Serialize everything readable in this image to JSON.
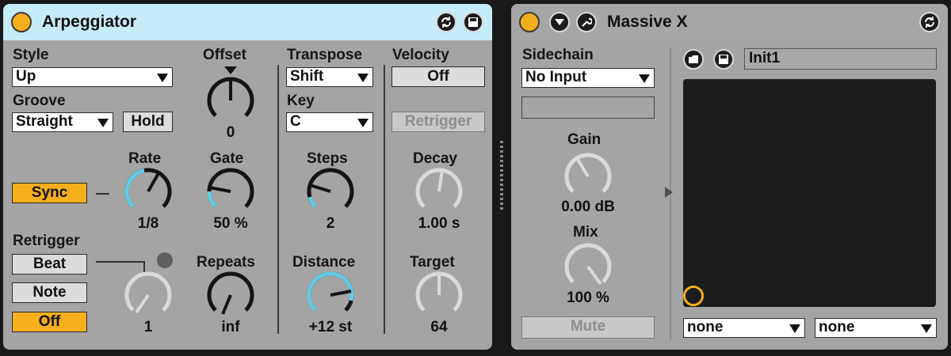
{
  "arpeggiator": {
    "title": "Arpeggiator",
    "style": {
      "label": "Style",
      "value": "Up"
    },
    "groove": {
      "label": "Groove",
      "value": "Straight"
    },
    "hold_label": "Hold",
    "offset": {
      "label": "Offset",
      "value": "0"
    },
    "sync_label": "Sync",
    "rate": {
      "label": "Rate",
      "value": "1/8"
    },
    "gate": {
      "label": "Gate",
      "value": "50 %"
    },
    "retrigger": {
      "label": "Retrigger",
      "beat": "Beat",
      "note": "Note",
      "off": "Off",
      "value": "1"
    },
    "repeats": {
      "label": "Repeats",
      "value": "inf"
    },
    "transpose": {
      "label": "Transpose",
      "value": "Shift"
    },
    "key": {
      "label": "Key",
      "value": "C"
    },
    "steps": {
      "label": "Steps",
      "value": "2"
    },
    "distance": {
      "label": "Distance",
      "value": "+12 st"
    },
    "velocity": {
      "label": "Velocity",
      "value": "Off",
      "retrigger_label": "Retrigger"
    },
    "decay": {
      "label": "Decay",
      "value": "1.00 s"
    },
    "target": {
      "label": "Target",
      "value": "64"
    }
  },
  "massive": {
    "title": "Massive X",
    "sidechain": {
      "label": "Sidechain",
      "value": "No Input"
    },
    "gain": {
      "label": "Gain",
      "value": "0.00 dB"
    },
    "mix": {
      "label": "Mix",
      "value": "100 %"
    },
    "mute_label": "Mute",
    "preset_name": "Init1",
    "macro_left": "none",
    "macro_right": "none"
  },
  "colors": {
    "accent": "#f5ae1c",
    "modulation": "#62cbe6",
    "panel": "#a4a4a4",
    "header_selected": "#c6ecf9",
    "header": "#a6a6a6",
    "display": "#1c1c1c"
  },
  "icons": [
    "power-button",
    "refresh-icon",
    "save-icon",
    "fold-arrow-icon",
    "wrench-icon",
    "folder-icon"
  ]
}
